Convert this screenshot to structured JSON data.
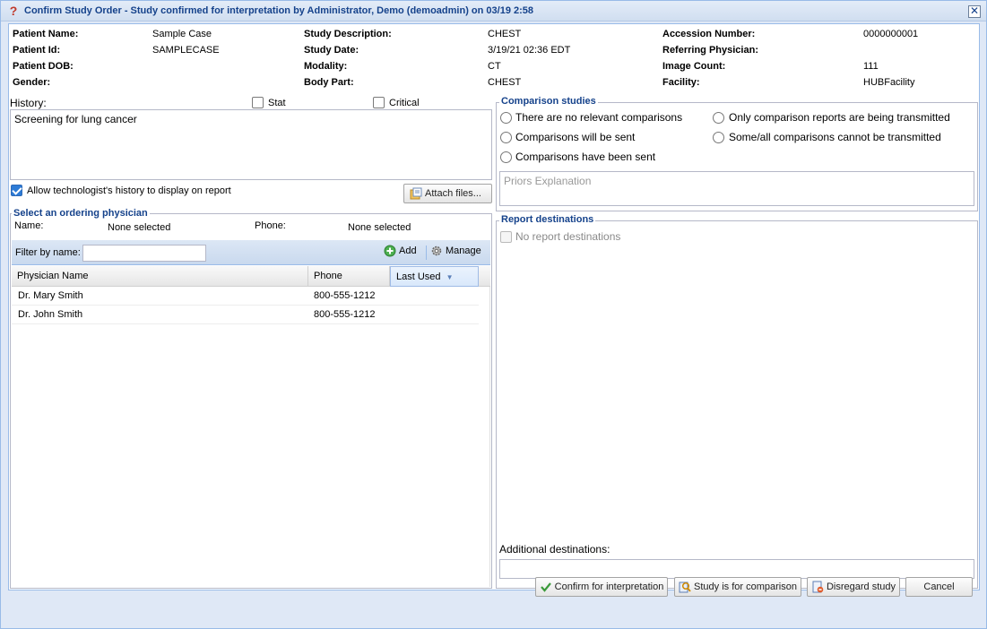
{
  "window": {
    "title": "Confirm Study Order - Study confirmed for interpretation by Administrator, Demo (demoadmin) on 03/19 2:58",
    "close_glyph": "✕"
  },
  "patient": {
    "name_label": "Patient Name:",
    "name": "Sample Case",
    "id_label": "Patient Id:",
    "id": "SAMPLECASE",
    "dob_label": "Patient DOB:",
    "dob": "",
    "gender_label": "Gender:",
    "gender": ""
  },
  "study": {
    "description_label": "Study Description:",
    "description": "CHEST",
    "date_label": "Study Date:",
    "date": "3/19/21 02:36 EDT",
    "modality_label": "Modality:",
    "modality": "CT",
    "body_part_label": "Body Part:",
    "body_part": "CHEST"
  },
  "order": {
    "accession_label": "Accession Number:",
    "accession": "0000000001",
    "referring_label": "Referring Physician:",
    "referring": "",
    "image_count_label": "Image Count:",
    "image_count": "111",
    "facility_label": "Facility:",
    "facility": "HUBFacility"
  },
  "history": {
    "label": "History:",
    "stat_label": "Stat",
    "stat_checked": false,
    "critical_label": "Critical",
    "critical_checked": false,
    "text": "Screening for lung cancer",
    "allow_label": "Allow technologist's history to display on report",
    "allow_checked": true,
    "attach_label": "Attach files..."
  },
  "physician": {
    "legend": "Select an ordering physician",
    "name_label": "Name:",
    "name_value": "None selected",
    "phone_label": "Phone:",
    "phone_value": "None selected",
    "filter_label": "Filter by name:",
    "filter_value": "",
    "add_label": "Add",
    "manage_label": "Manage",
    "columns": [
      "Physician Name",
      "Phone",
      "Last Used"
    ],
    "rows": [
      {
        "name": "Dr. Mary Smith",
        "phone": "800-555-1212",
        "last_used": ""
      },
      {
        "name": "Dr. John Smith",
        "phone": "800-555-1212",
        "last_used": ""
      }
    ]
  },
  "comparison": {
    "legend": "Comparison studies",
    "options": [
      "There are no relevant comparisons",
      "Only comparison reports are being transmitted",
      "Comparisons will be sent",
      "Some/all comparisons cannot be transmitted",
      "Comparisons have been sent"
    ],
    "priors_placeholder": "Priors Explanation"
  },
  "destinations": {
    "legend": "Report destinations",
    "none_label": "No report destinations",
    "additional_label": "Additional destinations:",
    "additional_value": ""
  },
  "footer": {
    "confirm_label": "Confirm for interpretation",
    "comparison_label": "Study is for comparison",
    "disregard_label": "Disregard study",
    "cancel_label": "Cancel"
  },
  "colors": {
    "accent": "#15428b",
    "border": "#99bbe8",
    "background": "#dfe8f6"
  }
}
